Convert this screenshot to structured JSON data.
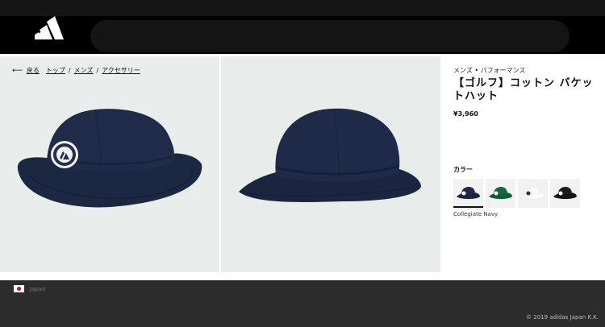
{
  "header": {
    "logo_icon": "adidas-logo-icon",
    "search_bar": ""
  },
  "breadcrumb": {
    "back_icon": "back-arrow-icon",
    "back_label": "戻る",
    "items": [
      "トップ",
      "メンズ",
      "アクセサリー"
    ],
    "separator": "/"
  },
  "gallery": {
    "images": [
      {
        "alt": "front view bucket hat with badge",
        "icon": "bucket-hat-front-image"
      },
      {
        "alt": "side view bucket hat",
        "icon": "bucket-hat-side-image"
      }
    ]
  },
  "product": {
    "category": "メンズ • パフォーマンス",
    "title": "【ゴルフ】コットン バケットハット",
    "price": "¥3,960",
    "color_label": "カラー",
    "swatches": [
      {
        "name": "navy",
        "color": "#1b2540",
        "badge": "#ffffff"
      },
      {
        "name": "green",
        "color": "#0e5c38",
        "badge": "#ffffff"
      },
      {
        "name": "white",
        "color": "#f4f4f4",
        "badge": "#333333"
      },
      {
        "name": "black",
        "color": "#141414",
        "badge": "#ffffff"
      }
    ],
    "selected_color_name": "Collegiate Navy"
  },
  "footer": {
    "country": "Japan",
    "flag_icon": "japan-flag-icon",
    "copyright": "© 2019 adidas Japan K.K."
  },
  "colors": {
    "header": "#000000",
    "gallery_bg": "#e9eeed",
    "footer": "#2c2c2c",
    "hat_navy": "#1d2a47"
  }
}
